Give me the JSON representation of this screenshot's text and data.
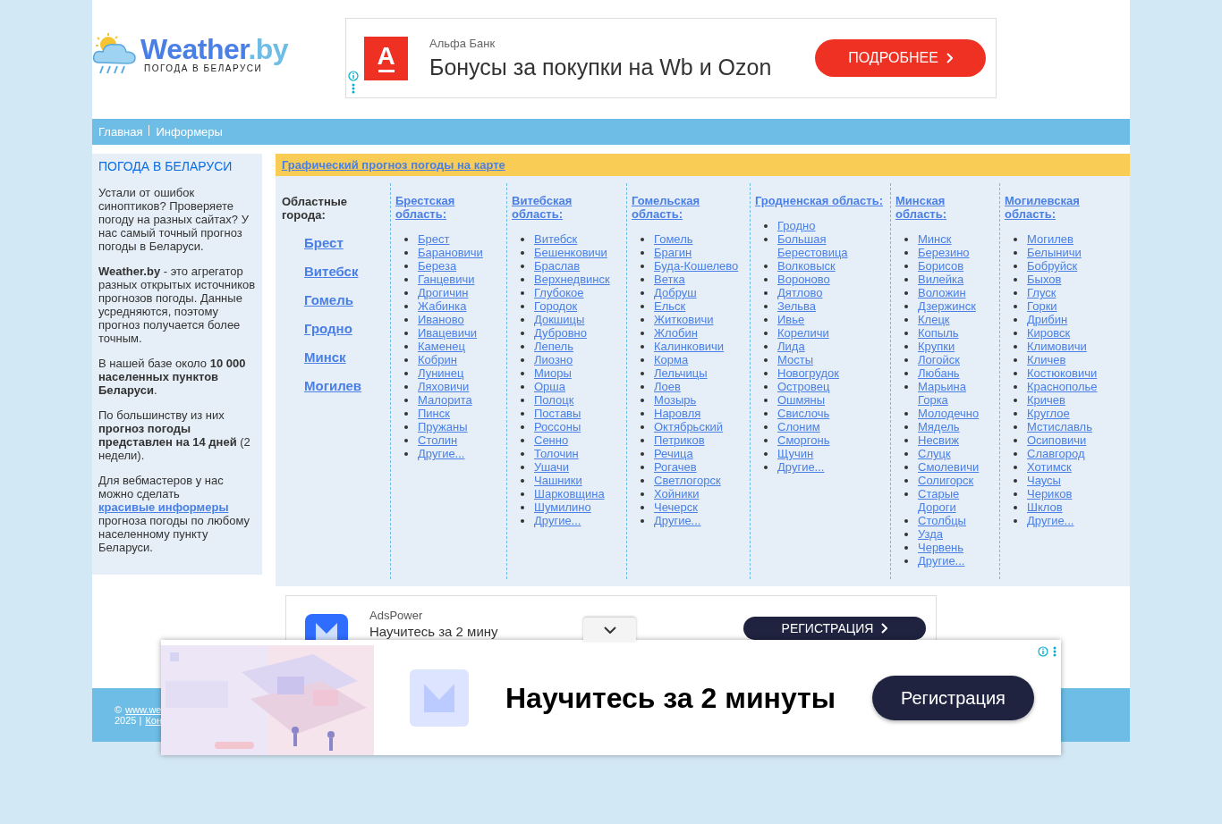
{
  "logo": {
    "name": "Weather",
    "tld": ".by",
    "tagline": "ПОГОДА В БЕЛАРУСИ"
  },
  "top_ad": {
    "logo_text": "А",
    "advertiser": "Альфа Банк",
    "headline": "Бонусы за покупки на Wb и Ozon",
    "button": "ПОДРОБНЕЕ"
  },
  "nav": [
    "Главная",
    "Информеры"
  ],
  "sidebar": {
    "title": "ПОГОДА В БЕЛАРУСИ",
    "paragraphs": [
      [
        {
          "text": "Устали от ошибок синоптиков? Проверяете погоду на разных сайтах? У нас самый точный прогноз погоды в Беларуси."
        }
      ],
      [
        {
          "text": "**Weather.by** - это агрегатор разных открытых источников прогнозов погоды. Данные усредняются, поэтому прогноз получается более точным."
        }
      ],
      [
        {
          "text": "В нашей базе около **10 000 населенных пунктов Беларуси**."
        }
      ],
      [
        {
          "text": "По большинству из них **прогноз погоды представлен на 14 дней** (2 недели)."
        }
      ],
      [
        {
          "text": "Для вебмастеров у нас можно сделать "
        },
        {
          "link": "красивые информеры"
        },
        {
          "text": " прогноза погоды по любому населенному пункту Беларуси."
        }
      ]
    ]
  },
  "map_link": "Графический прогноз погоды на карте",
  "regional_cities": {
    "title": "Областные города:",
    "cities": [
      "Брест",
      "Витебск",
      "Гомель",
      "Гродно",
      "Минск",
      "Могилев"
    ]
  },
  "regions": [
    {
      "title": "Брестская область:",
      "cities": [
        "Брест",
        "Барановичи",
        "Береза",
        "Ганцевичи",
        "Дрогичин",
        "Жабинка",
        "Иваново",
        "Ивацевичи",
        "Каменец",
        "Кобрин",
        "Лунинец",
        "Ляховичи",
        "Малорита",
        "Пинск",
        "Пружаны",
        "Столин",
        "Другие..."
      ]
    },
    {
      "title": "Витебская область:",
      "cities": [
        "Витебск",
        "Бешенковичи",
        "Браслав",
        "Верхнедвинск",
        "Глубокое",
        "Городок",
        "Докшицы",
        "Дубровно",
        "Лепель",
        "Лиозно",
        "Миоры",
        "Орша",
        "Полоцк",
        "Поставы",
        "Россоны",
        "Сенно",
        "Толочин",
        "Ушачи",
        "Чашники",
        "Шарковщина",
        "Шумилино",
        "Другие..."
      ]
    },
    {
      "title": "Гомельская область:",
      "cities": [
        "Гомель",
        "Брагин",
        "Буда-Кошелево",
        "Ветка",
        "Добруш",
        "Ельск",
        "Житковичи",
        "Жлобин",
        "Калинковичи",
        "Корма",
        "Лельчицы",
        "Лоев",
        "Мозырь",
        "Наровля",
        "Октябрьский",
        "Петриков",
        "Речица",
        "Рогачев",
        "Светлогорск",
        "Хойники",
        "Чечерск",
        "Другие..."
      ]
    },
    {
      "title": "Гродненская область:",
      "cities": [
        "Гродно",
        "Большая Берестовица",
        "Волковыск",
        "Вороново",
        "Дятлово",
        "Зельва",
        "Ивье",
        "Кореличи",
        "Лида",
        "Мосты",
        "Новогрудок",
        "Островец",
        "Ошмяны",
        "Свислочь",
        "Слоним",
        "Сморгонь",
        "Щучин",
        "Другие..."
      ]
    },
    {
      "title": "Минская область:",
      "cities": [
        "Минск",
        "Березино",
        "Борисов",
        "Вилейка",
        "Воложин",
        "Дзержинск",
        "Клецк",
        "Копыль",
        "Крупки",
        "Логойск",
        "Любань",
        "Марьина Горка",
        "Молодечно",
        "Мядель",
        "Несвиж",
        "Слуцк",
        "Смолевичи",
        "Солигорск",
        "Старые Дороги",
        "Столбцы",
        "Узда",
        "Червень",
        "Другие..."
      ]
    },
    {
      "title": "Могилевская область:",
      "cities": [
        "Могилев",
        "Белыничи",
        "Бобруйск",
        "Быхов",
        "Глуск",
        "Горки",
        "Дрибин",
        "Кировск",
        "Климовичи",
        "Кличев",
        "Костюковичи",
        "Краснополье",
        "Кричев",
        "Круглое",
        "Мстиславль",
        "Осиповичи",
        "Славгород",
        "Хотимск",
        "Чаусы",
        "Чериков",
        "Шклов",
        "Другие..."
      ]
    }
  ],
  "bottom_ad": {
    "advertiser": "AdsPower",
    "headline": "Научитесь за 2 мину",
    "button": "РЕГИСТРАЦИЯ"
  },
  "footer": {
    "line_1_prefix": "©",
    "line_1_link": "www.we",
    "line_2_prefix": "2025 |",
    "line_2_link": "Кон"
  },
  "sticky_ad": {
    "headline": "Научитесь за 2 минуты",
    "button": "Регистрация"
  }
}
